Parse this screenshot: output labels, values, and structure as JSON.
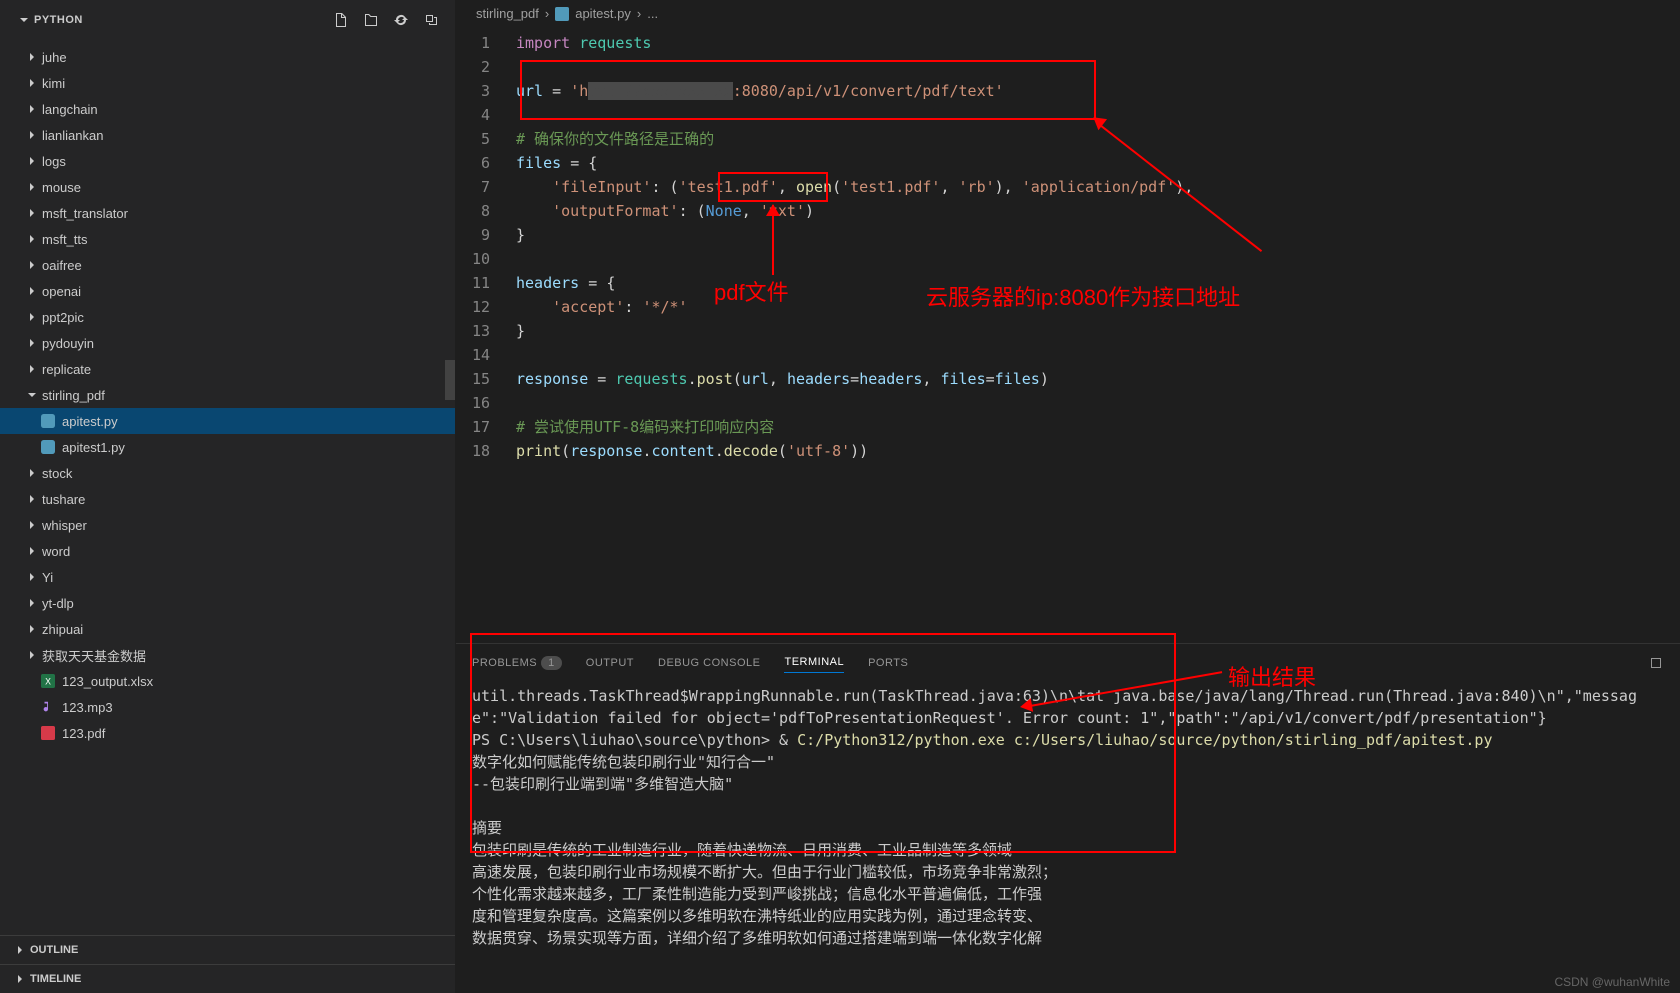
{
  "sidebar": {
    "title": "PYTHON",
    "folders": [
      {
        "name": "juhe",
        "expanded": false
      },
      {
        "name": "kimi",
        "expanded": false
      },
      {
        "name": "langchain",
        "expanded": false
      },
      {
        "name": "lianliankan",
        "expanded": false
      },
      {
        "name": "logs",
        "expanded": false
      },
      {
        "name": "mouse",
        "expanded": false
      },
      {
        "name": "msft_translator",
        "expanded": false
      },
      {
        "name": "msft_tts",
        "expanded": false
      },
      {
        "name": "oaifree",
        "expanded": false
      },
      {
        "name": "openai",
        "expanded": false
      },
      {
        "name": "ppt2pic",
        "expanded": false
      },
      {
        "name": "pydouyin",
        "expanded": false
      },
      {
        "name": "replicate",
        "expanded": false
      },
      {
        "name": "stirling_pdf",
        "expanded": true
      },
      {
        "name": "stock",
        "expanded": false
      },
      {
        "name": "tushare",
        "expanded": false
      },
      {
        "name": "whisper",
        "expanded": false
      },
      {
        "name": "word",
        "expanded": false
      },
      {
        "name": "Yi",
        "expanded": false
      },
      {
        "name": "yt-dlp",
        "expanded": false
      },
      {
        "name": "zhipuai",
        "expanded": false
      },
      {
        "name": "获取天天基金数据",
        "expanded": false
      }
    ],
    "stirling_files": [
      {
        "name": "apitest.py",
        "selected": true,
        "type": "python"
      },
      {
        "name": "apitest1.py",
        "selected": false,
        "type": "python"
      }
    ],
    "root_files": [
      {
        "name": "123_output.xlsx",
        "type": "excel"
      },
      {
        "name": "123.mp3",
        "type": "audio"
      },
      {
        "name": "123.pdf",
        "type": "pdf"
      }
    ],
    "sections": [
      "OUTLINE",
      "TIMELINE"
    ]
  },
  "breadcrumb": {
    "parts": [
      "stirling_pdf",
      "apitest.py",
      "..."
    ]
  },
  "editor": {
    "lines": [
      {
        "n": "1",
        "html": "<span class='kw'>import</span> <span class='mod'>requests</span>"
      },
      {
        "n": "2",
        "html": ""
      },
      {
        "n": "3",
        "html": "<span class='var'>url</span> <span class='op'>=</span> <span class='str'>'h<span style='background:#4a4a4a;color:#4a4a4a'>ttp://xxx.xxx.xx</span>:8080/api/v1/convert/pdf/text'</span>"
      },
      {
        "n": "4",
        "html": ""
      },
      {
        "n": "5",
        "html": "<span class='cmt'># 确保你的文件路径是正确的</span>"
      },
      {
        "n": "6",
        "html": "<span class='var'>files</span> <span class='op'>=</span> <span class='op'>{</span>"
      },
      {
        "n": "7",
        "html": "    <span class='str'>'fileInput'</span><span class='op'>:</span> <span class='op'>(</span><span class='str'>'test1.pdf'</span><span class='op'>,</span> <span class='fn'>open</span><span class='op'>(</span><span class='str'>'test1.pdf'</span><span class='op'>,</span> <span class='str'>'rb'</span><span class='op'>),</span> <span class='str'>'application/pdf'</span><span class='op'>),</span>"
      },
      {
        "n": "8",
        "html": "    <span class='str'>'outputFormat'</span><span class='op'>:</span> <span class='op'>(</span><span class='const'>None</span><span class='op'>,</span> <span class='str'>'txt'</span><span class='op'>)</span>"
      },
      {
        "n": "9",
        "html": "<span class='op'>}</span>"
      },
      {
        "n": "10",
        "html": ""
      },
      {
        "n": "11",
        "html": "<span class='var'>headers</span> <span class='op'>=</span> <span class='op'>{</span>"
      },
      {
        "n": "12",
        "html": "    <span class='str'>'accept'</span><span class='op'>:</span> <span class='str'>'*/*'</span>"
      },
      {
        "n": "13",
        "html": "<span class='op'>}</span>"
      },
      {
        "n": "14",
        "html": ""
      },
      {
        "n": "15",
        "html": "<span class='var'>response</span> <span class='op'>=</span> <span class='mod'>requests</span><span class='op'>.</span><span class='fn'>post</span><span class='op'>(</span><span class='var'>url</span><span class='op'>,</span> <span class='var'>headers</span><span class='op'>=</span><span class='var'>headers</span><span class='op'>,</span> <span class='var'>files</span><span class='op'>=</span><span class='var'>files</span><span class='op'>)</span>"
      },
      {
        "n": "16",
        "html": ""
      },
      {
        "n": "17",
        "html": "<span class='cmt'># 尝试使用UTF-8编码来打印响应内容</span>"
      },
      {
        "n": "18",
        "html": "<span class='fn'>print</span><span class='op'>(</span><span class='var'>response</span><span class='op'>.</span><span class='var'>content</span><span class='op'>.</span><span class='fn'>decode</span><span class='op'>(</span><span class='str'>'utf-8'</span><span class='op'>))</span>"
      }
    ]
  },
  "terminal": {
    "tabs": [
      {
        "label": "PROBLEMS",
        "badge": "1"
      },
      {
        "label": "OUTPUT"
      },
      {
        "label": "DEBUG CONSOLE"
      },
      {
        "label": "TERMINAL",
        "active": true
      },
      {
        "label": "PORTS"
      }
    ],
    "lines": [
      "util.threads.TaskThread$WrappingRunnable.run(TaskThread.java:63)\\n\\tat java.base/java/lang/Thread.run(Thread.java:840)\\n\",\"message\":\"Validation failed for object='pdfToPresentationRequest'. Error count: 1\",\"path\":\"/api/v1/convert/pdf/presentation\"}",
      "PS C:\\Users\\liuhao\\source\\python> & C:/Python312/python.exe c:/Users/liuhao/source/python/stirling_pdf/apitest.py",
      "数字化如何赋能传统包装印刷行业\"知行合一\"",
      "--包装印刷行业端到端\"多维智造大脑\"",
      "",
      "摘要",
      "包装印刷是传统的工业制造行业，随着快递物流、日用消费、工业品制造等多领域",
      "高速发展，包装印刷行业市场规模不断扩大。但由于行业门槛较低，市场竞争非常激烈；",
      "个性化需求越来越多，工厂柔性制造能力受到严峻挑战；信息化水平普遍偏低，工作强",
      "度和管理复杂度高。这篇案例以多维明软在沸特纸业的应用实践为例，通过理念转变、",
      "数据贯穿、场景实现等方面，详细介绍了多维明软如何通过搭建端到端一体化数字化解"
    ]
  },
  "annotations": {
    "pdf_label": "pdf文件",
    "server_label": "云服务器的ip:8080作为接口地址",
    "output_label": "输出结果"
  },
  "watermark": "CSDN @wuhanWhite"
}
